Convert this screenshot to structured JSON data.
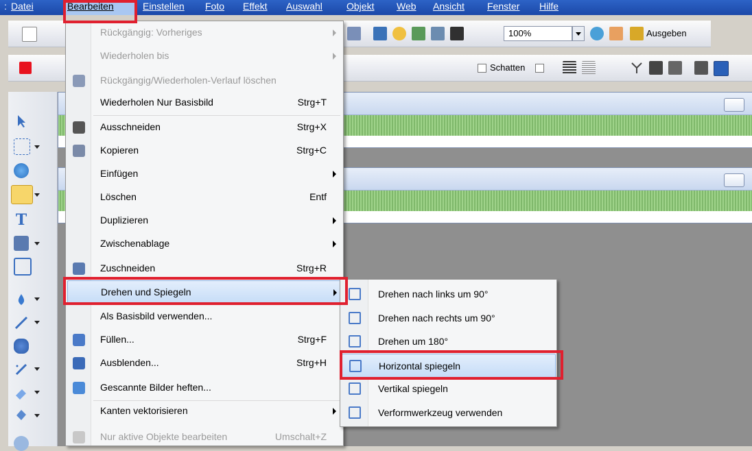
{
  "menubar": {
    "items": [
      "Datei",
      "Bearbeiten",
      "Einstellen",
      "Foto",
      "Effekt",
      "Auswahl",
      "Objekt",
      "Web",
      "Ansicht",
      "Fenster",
      "Hilfe"
    ]
  },
  "toolbar": {
    "zoom": "100%",
    "export_label": "Ausgeben",
    "shadow_label": "Schatten"
  },
  "edit_menu": {
    "items": [
      {
        "label": "Rückgängig: Vorheriges",
        "shortcut": "",
        "submenu": true,
        "disabled": true,
        "icon": ""
      },
      {
        "label": "Wiederholen bis",
        "shortcut": "",
        "submenu": true,
        "disabled": true,
        "icon": ""
      },
      {
        "label": "Rückgängig/Wiederholen-Verlauf löschen",
        "shortcut": "",
        "submenu": false,
        "disabled": true,
        "icon": "history-clear-icon"
      },
      {
        "label": "Wiederholen Nur Basisbild",
        "shortcut": "Strg+T",
        "submenu": false,
        "disabled": false,
        "icon": ""
      },
      {
        "label": "Ausschneiden",
        "shortcut": "Strg+X",
        "submenu": false,
        "disabled": false,
        "icon": "scissors-icon"
      },
      {
        "label": "Kopieren",
        "shortcut": "Strg+C",
        "submenu": false,
        "disabled": false,
        "icon": "copy-icon"
      },
      {
        "label": "Einfügen",
        "shortcut": "",
        "submenu": true,
        "disabled": false,
        "icon": ""
      },
      {
        "label": "Löschen",
        "shortcut": "Entf",
        "submenu": false,
        "disabled": false,
        "icon": ""
      },
      {
        "label": "Duplizieren",
        "shortcut": "",
        "submenu": true,
        "disabled": false,
        "icon": ""
      },
      {
        "label": "Zwischenablage",
        "shortcut": "",
        "submenu": true,
        "disabled": false,
        "icon": ""
      },
      {
        "label": "Zuschneiden",
        "shortcut": "Strg+R",
        "submenu": false,
        "disabled": false,
        "icon": "crop-icon"
      },
      {
        "label": "Drehen und Spiegeln",
        "shortcut": "",
        "submenu": true,
        "disabled": false,
        "icon": "",
        "highlighted": true
      },
      {
        "label": "Als Basisbild verwenden...",
        "shortcut": "",
        "submenu": false,
        "disabled": false,
        "icon": ""
      },
      {
        "label": "Füllen...",
        "shortcut": "Strg+F",
        "submenu": false,
        "disabled": false,
        "icon": "fill-icon"
      },
      {
        "label": "Ausblenden...",
        "shortcut": "Strg+H",
        "submenu": false,
        "disabled": false,
        "icon": "fade-icon"
      },
      {
        "label": "Gescannte Bilder heften...",
        "shortcut": "",
        "submenu": false,
        "disabled": false,
        "icon": "stitch-icon"
      },
      {
        "label": "Kanten vektorisieren",
        "shortcut": "",
        "submenu": true,
        "disabled": false,
        "icon": ""
      },
      {
        "label": "Nur aktive Objekte bearbeiten",
        "shortcut": "Umschalt+Z",
        "submenu": false,
        "disabled": true,
        "icon": "active-objects-icon"
      }
    ]
  },
  "rotate_submenu": {
    "items": [
      {
        "label": "Drehen nach links um 90°",
        "icon": "rotate-left-icon"
      },
      {
        "label": "Drehen nach rechts um 90°",
        "icon": "rotate-right-icon"
      },
      {
        "label": "Drehen um 180°",
        "icon": "rotate-180-icon"
      },
      {
        "label": "Horizontal spiegeln",
        "icon": "flip-horizontal-icon",
        "highlighted": true
      },
      {
        "label": "Vertikal spiegeln",
        "icon": "flip-vertical-icon"
      },
      {
        "label": "Verformwerkzeug verwenden",
        "icon": "distort-icon"
      }
    ]
  },
  "colors": {
    "menubar": "#2d63c6",
    "highlight_box": "#e0202f",
    "menu_hover": "#c5dcf7"
  }
}
